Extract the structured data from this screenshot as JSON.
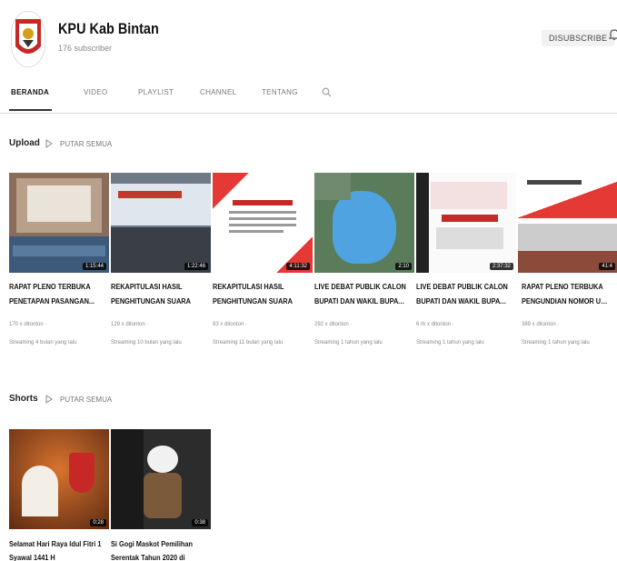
{
  "channel": {
    "name": "KPU Kab Bintan",
    "subscribers": "176 subscriber",
    "subscribe_label": "DISUBSCRIBE"
  },
  "tabs": [
    {
      "label": "BERANDA",
      "active": true
    },
    {
      "label": "VIDEO",
      "active": false
    },
    {
      "label": "PLAYLIST",
      "active": false
    },
    {
      "label": "CHANNEL",
      "active": false
    },
    {
      "label": "TENTANG",
      "active": false
    }
  ],
  "upload_section": {
    "title": "Upload",
    "play_all": "PUTAR SEMUA",
    "videos": [
      {
        "title": "RAPAT PLENO TERBUKA",
        "title2": "PENETAPAN PASANGAN...",
        "duration": "1:15:44",
        "views": "170 x ditonton ·",
        "when": "Streaming 4 bulan yang lalu"
      },
      {
        "title": "REKAPITULASI HASIL",
        "title2": "PENGHITUNGAN SUARA",
        "duration": "1:22:46",
        "views": "129 x ditonton ·",
        "when": "Streaming 10 bulan yang lalu"
      },
      {
        "title": "REKAPITULASI HASIL",
        "title2": "PENGHITUNGAN SUARA",
        "duration": "4:11:32",
        "views": "93 x ditonton ·",
        "when": "Streaming 11 bulan yang lalu"
      },
      {
        "title": "LIVE DEBAT PUBLIK CALON",
        "title2": "BUPATI DAN WAKIL BUPATI...",
        "duration": "2:10",
        "views": "292 x ditonton ·",
        "when": "Streaming 1 tahun yang lalu"
      },
      {
        "title": "LIVE DEBAT PUBLIK CALON",
        "title2": "BUPATI DAN WAKIL BUPATI...",
        "duration": "2:37:32",
        "views": "6 rb x ditonton ·",
        "when": "Streaming 1 tahun yang lalu"
      },
      {
        "title": "RAPAT PLENO TERBUKA",
        "title2": "PENGUNDIAN NOMOR URU...",
        "duration": "41:4",
        "views": "389 x ditonton ·",
        "when": "Streaming 1 tahun yang lalu"
      }
    ]
  },
  "shorts_section": {
    "title": "Shorts",
    "play_all": "PUTAR SEMUA",
    "videos": [
      {
        "title": "Selamat Hari Raya Idul Fitri 1",
        "title2": "Syawal 1441 H",
        "duration": "0:28"
      },
      {
        "title": "Si Gogi Maskot Pemilihan",
        "title2": "Serentak Tahun 2020 di",
        "duration": "0:38"
      }
    ]
  },
  "colors": {
    "accent_red": "#d32f2f",
    "background": "#ffffff",
    "text_primary": "#111111",
    "text_secondary": "#888888"
  }
}
